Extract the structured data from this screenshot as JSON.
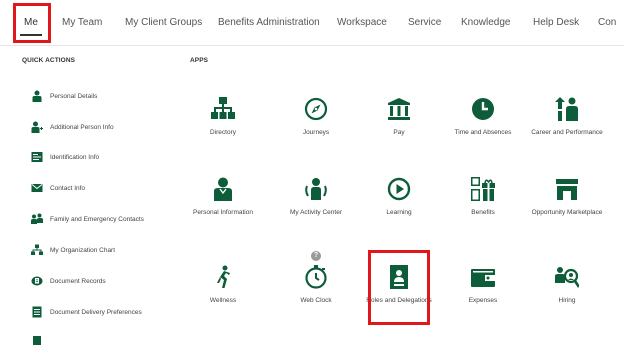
{
  "nav": {
    "tabs": [
      {
        "label": "Me"
      },
      {
        "label": "My Team"
      },
      {
        "label": "My Client Groups"
      },
      {
        "label": "Benefits Administration"
      },
      {
        "label": "Workspace"
      },
      {
        "label": "Service"
      },
      {
        "label": "Knowledge"
      },
      {
        "label": "Help Desk"
      },
      {
        "label": "Con"
      }
    ]
  },
  "quick_actions": {
    "title": "QUICK ACTIONS",
    "items": [
      {
        "label": "Personal Details",
        "icon": "person-icon"
      },
      {
        "label": "Additional Person Info",
        "icon": "person-plus-icon"
      },
      {
        "label": "Identification Info",
        "icon": "id-card-icon"
      },
      {
        "label": "Contact Info",
        "icon": "envelope-icon"
      },
      {
        "label": "Family and Emergency Contacts",
        "icon": "family-icon"
      },
      {
        "label": "My Organization Chart",
        "icon": "org-chart-icon"
      },
      {
        "label": "Document Records",
        "icon": "document-records-icon"
      },
      {
        "label": "Document Delivery Preferences",
        "icon": "document-list-icon"
      }
    ]
  },
  "apps": {
    "title": "APPS",
    "items": [
      {
        "label": "Directory",
        "icon": "directory-icon"
      },
      {
        "label": "Journeys",
        "icon": "compass-icon"
      },
      {
        "label": "Pay",
        "icon": "bank-icon"
      },
      {
        "label": "Time and Absences",
        "icon": "clock-icon"
      },
      {
        "label": "Career and Performance",
        "icon": "career-icon"
      },
      {
        "label": "Personal Information",
        "icon": "person-icon"
      },
      {
        "label": "My Activity Center",
        "icon": "activity-icon"
      },
      {
        "label": "Learning",
        "icon": "play-icon"
      },
      {
        "label": "Benefits",
        "icon": "gift-icon"
      },
      {
        "label": "Opportunity Marketplace",
        "icon": "store-icon"
      },
      {
        "label": "Wellness",
        "icon": "runner-icon"
      },
      {
        "label": "Web Clock",
        "icon": "stopwatch-icon"
      },
      {
        "label": "Roles and Delegations",
        "icon": "badge-icon"
      },
      {
        "label": "Expenses",
        "icon": "wallet-icon"
      },
      {
        "label": "Hiring",
        "icon": "hiring-icon"
      }
    ],
    "help_badge": "?"
  },
  "colors": {
    "icon": "#0d5c3a",
    "highlight": "#e0161b"
  }
}
